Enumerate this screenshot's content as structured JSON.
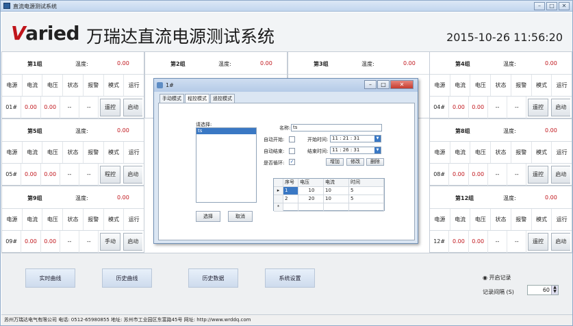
{
  "window": {
    "title": "直流电源测试系统",
    "minimize": "–",
    "maximize": "□",
    "close": "✕"
  },
  "header": {
    "logo_accent": "V",
    "logo_rest": "aried",
    "system_title": "万瑞达直流电源测试系统",
    "datetime": "2015-10-26 11:56:20"
  },
  "column_labels": [
    "电源",
    "电流",
    "电压",
    "状态",
    "报警",
    "模式",
    "运行"
  ],
  "temp_label": "温度:",
  "groups": [
    {
      "name": "第1组",
      "temp": "0.00",
      "id": "01#",
      "current": "0.00",
      "voltage": "0.00",
      "status": "--",
      "alarm": "--",
      "mode": "遥控",
      "run": "启动"
    },
    {
      "name": "第2组",
      "temp": "0.00"
    },
    {
      "name": "第3组",
      "temp": "0.00"
    },
    {
      "name": "第4组",
      "temp": "0.00",
      "id": "04#",
      "current": "0.00",
      "voltage": "0.00",
      "status": "--",
      "alarm": "--",
      "mode": "遥控",
      "run": "启动"
    },
    {
      "name": "第5组",
      "temp": "0.00",
      "id": "05#",
      "current": "0.00",
      "voltage": "0.00",
      "status": "--",
      "alarm": "--",
      "mode": "程控",
      "run": "启动"
    },
    {
      "name": "第8组",
      "temp": "0.00",
      "id": "08#",
      "current": "0.00",
      "voltage": "0.00",
      "status": "--",
      "alarm": "--",
      "mode": "遥控",
      "run": "启动"
    },
    {
      "name": "第9组",
      "temp": "0.00",
      "id": "09#",
      "current": "0.00",
      "voltage": "0.00",
      "status": "--",
      "alarm": "--",
      "mode": "手动",
      "run": "启动"
    },
    {
      "name": "第12组",
      "temp": "0.00",
      "id": "12#",
      "current": "0.00",
      "voltage": "0.00",
      "status": "--",
      "alarm": "--",
      "mode": "遥控",
      "run": "启动"
    }
  ],
  "bottom": {
    "buttons": [
      "实时曲线",
      "历史曲线",
      "历史数据",
      "系统设置"
    ],
    "record_label": "开启记录",
    "interval_label": "记录间隔 (S)",
    "interval_value": "60"
  },
  "status_bar": "苏州万瑞达电气有限公司  电话: 0512-65980855  地址: 苏州市工业园区东富路45号  网址: http://www.wrddq.com",
  "dialog": {
    "title": "1#",
    "tabs": [
      "手动模式",
      "程控模式",
      "遥控模式"
    ],
    "pick_label": "请选择:",
    "list_items": [
      "ts"
    ],
    "select_button": "选择",
    "cancel_button": "取消",
    "name_label": "名称:",
    "name_value": "ts",
    "auto_start_label": "自动开始:",
    "start_time_label": "开始时间:",
    "start_time": "11 : 21 : 31",
    "auto_end_label": "自动结束:",
    "end_time_label": "结束时间:",
    "end_time": "11 : 26 : 31",
    "loop_label": "是否循环:",
    "loop_check": "✓",
    "add_button": "增加",
    "edit_button": "修改",
    "delete_button": "删除",
    "table_headers": [
      "序号",
      "电压",
      "电流",
      "时间"
    ],
    "table_rows": [
      [
        "1",
        "10",
        "10",
        "5"
      ],
      [
        "2",
        "20",
        "10",
        "5"
      ]
    ],
    "row_marker": "▸",
    "new_row_marker": "*"
  }
}
